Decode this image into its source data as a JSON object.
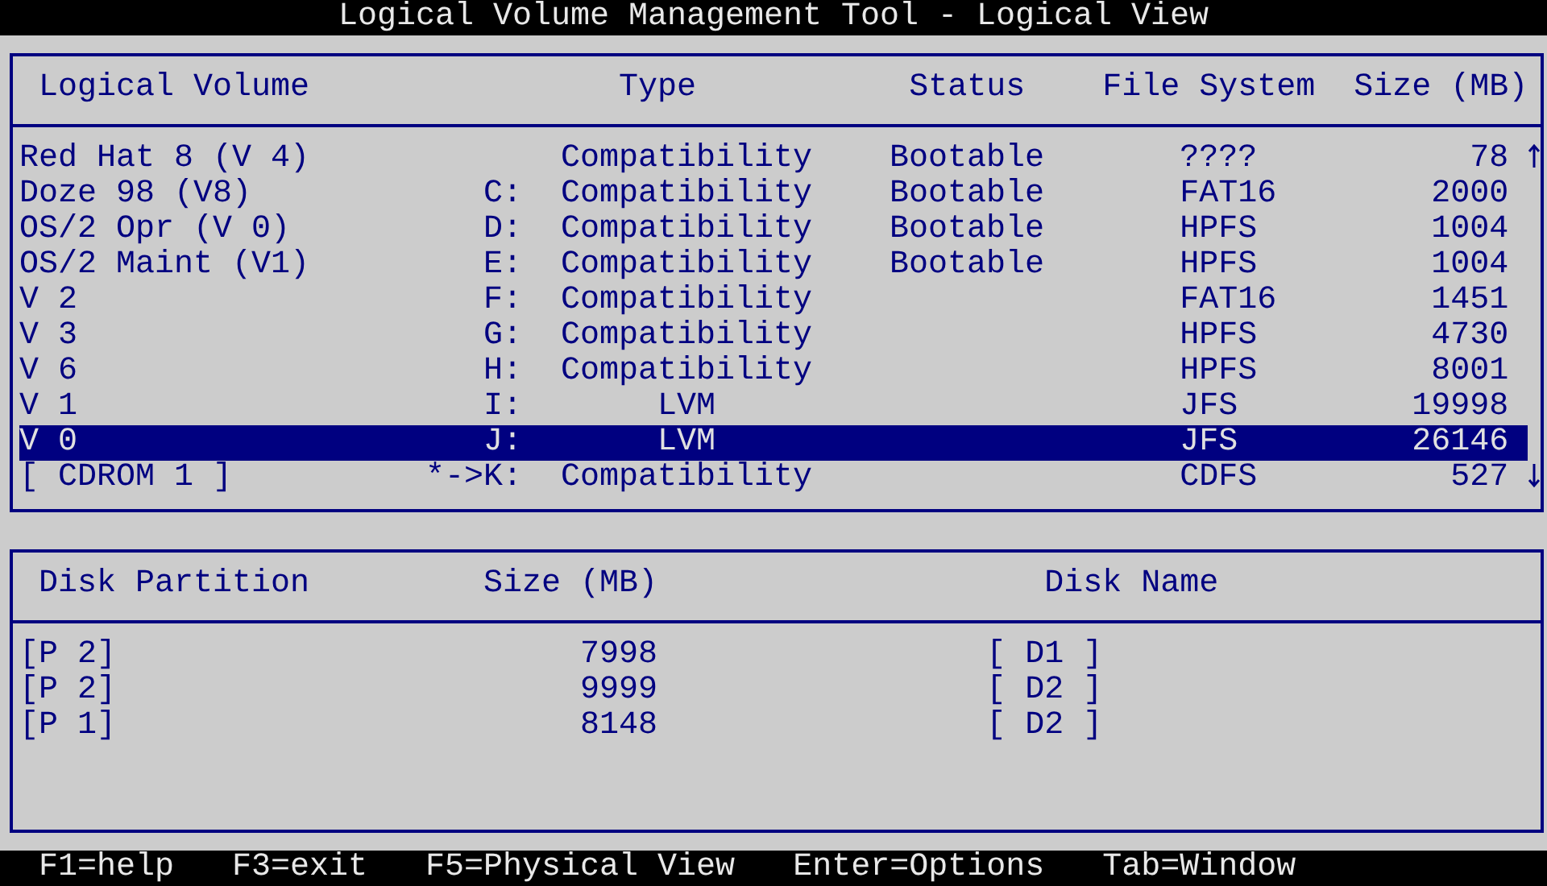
{
  "window": {
    "title": "Logical Volume Management Tool - Logical View"
  },
  "volumes": {
    "columns": [
      "Logical Volume",
      "Type",
      "Status",
      "File System",
      "Size (MB)"
    ],
    "rows": [
      {
        "name": "Red Hat 8 (V 4)",
        "drive": "",
        "type": "Compatibility",
        "status": "Bootable",
        "file_system": "????",
        "size": "78",
        "selected": false
      },
      {
        "name": "Doze 98 (V8)",
        "drive": "C:",
        "type": "Compatibility",
        "status": "Bootable",
        "file_system": "FAT16",
        "size": "2000",
        "selected": false
      },
      {
        "name": "OS/2 Opr (V 0)",
        "drive": "D:",
        "type": "Compatibility",
        "status": "Bootable",
        "file_system": "HPFS",
        "size": "1004",
        "selected": false
      },
      {
        "name": "OS/2 Maint (V1)",
        "drive": "E:",
        "type": "Compatibility",
        "status": "Bootable",
        "file_system": "HPFS",
        "size": "1004",
        "selected": false
      },
      {
        "name": "V 2",
        "drive": "F:",
        "type": "Compatibility",
        "status": "",
        "file_system": "FAT16",
        "size": "1451",
        "selected": false
      },
      {
        "name": "V 3",
        "drive": "G:",
        "type": "Compatibility",
        "status": "",
        "file_system": "HPFS",
        "size": "4730",
        "selected": false
      },
      {
        "name": "V 6",
        "drive": "H:",
        "type": "Compatibility",
        "status": "",
        "file_system": "HPFS",
        "size": "8001",
        "selected": false
      },
      {
        "name": "V 1",
        "drive": "I:",
        "type": "LVM",
        "status": "",
        "file_system": "JFS",
        "size": "19998",
        "selected": false
      },
      {
        "name": "V 0",
        "drive": "J:",
        "type": "LVM",
        "status": "",
        "file_system": "JFS",
        "size": "26146",
        "selected": true
      },
      {
        "name": "[ CDROM 1 ]",
        "drive": "*->K:",
        "type": "Compatibility",
        "status": "",
        "file_system": "CDFS",
        "size": "527",
        "selected": false
      }
    ]
  },
  "partitions": {
    "columns": [
      "Disk Partition",
      "Size (MB)",
      "Disk Name"
    ],
    "rows": [
      {
        "partition": "[P 2]",
        "size": "7998",
        "disk": "[ D1 ]"
      },
      {
        "partition": "[P 2]",
        "size": "9999",
        "disk": "[ D2 ]"
      },
      {
        "partition": "[P 1]",
        "size": "8148",
        "disk": "[ D2 ]"
      }
    ]
  },
  "status_bar": [
    "F1=help",
    "F3=exit",
    "F5=Physical View",
    "Enter=Options",
    "Tab=Window"
  ]
}
